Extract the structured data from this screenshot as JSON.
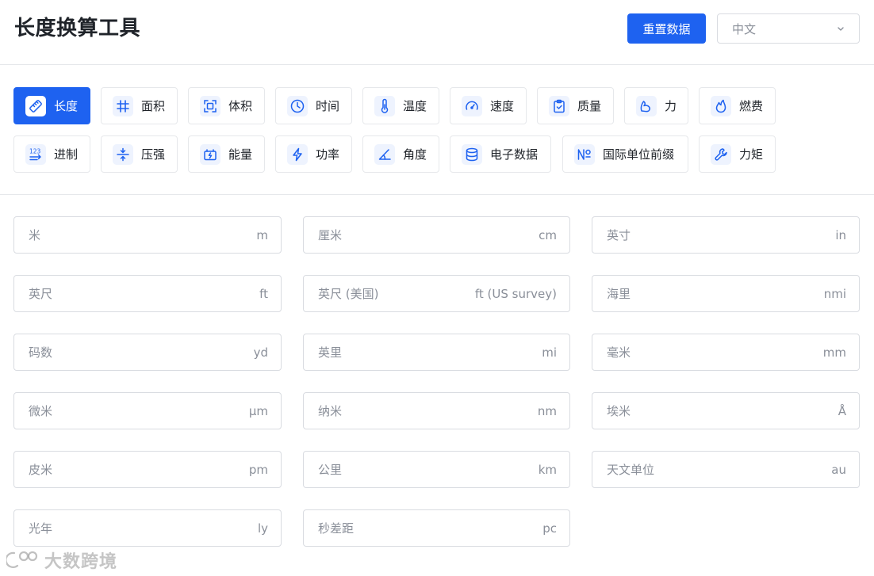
{
  "header": {
    "title": "长度换算工具",
    "reset_label": "重置数据",
    "language": {
      "selected": "中文"
    }
  },
  "colors": {
    "accent": "#1e62f0",
    "border": "#d9dce1",
    "muted": "#8a8f99"
  },
  "categories": [
    {
      "label": "长度",
      "icon": "ruler-icon",
      "active": true
    },
    {
      "label": "面积",
      "icon": "grid-hash-icon"
    },
    {
      "label": "体积",
      "icon": "volume-frame-icon"
    },
    {
      "label": "时间",
      "icon": "clock-icon"
    },
    {
      "label": "温度",
      "icon": "thermometer-icon"
    },
    {
      "label": "速度",
      "icon": "speedometer-icon"
    },
    {
      "label": "质量",
      "icon": "clipboard-icon"
    },
    {
      "label": "力",
      "icon": "bicep-icon"
    },
    {
      "label": "燃费",
      "icon": "flame-icon"
    },
    {
      "label": "进制",
      "icon": "number-base-icon"
    },
    {
      "label": "压强",
      "icon": "compress-icon"
    },
    {
      "label": "能量",
      "icon": "battery-icon"
    },
    {
      "label": "功率",
      "icon": "lightning-icon"
    },
    {
      "label": "角度",
      "icon": "angle-icon"
    },
    {
      "label": "电子数据",
      "icon": "database-icon"
    },
    {
      "label": "国际单位前缀",
      "icon": "numero-icon"
    },
    {
      "label": "力矩",
      "icon": "wrench-icon"
    }
  ],
  "fields": [
    {
      "name": "米",
      "unit": "m",
      "value": ""
    },
    {
      "name": "厘米",
      "unit": "cm",
      "value": ""
    },
    {
      "name": "英寸",
      "unit": "in",
      "value": ""
    },
    {
      "name": "英尺",
      "unit": "ft",
      "value": ""
    },
    {
      "name": "英尺 (美国)",
      "unit": "ft (US survey)",
      "value": ""
    },
    {
      "name": "海里",
      "unit": "nmi",
      "value": ""
    },
    {
      "name": "码数",
      "unit": "yd",
      "value": ""
    },
    {
      "name": "英里",
      "unit": "mi",
      "value": ""
    },
    {
      "name": "毫米",
      "unit": "mm",
      "value": ""
    },
    {
      "name": "微米",
      "unit": "µm",
      "value": ""
    },
    {
      "name": "纳米",
      "unit": "nm",
      "value": ""
    },
    {
      "name": "埃米",
      "unit": "Å",
      "value": ""
    },
    {
      "name": "皮米",
      "unit": "pm",
      "value": ""
    },
    {
      "name": "公里",
      "unit": "km",
      "value": ""
    },
    {
      "name": "天文单位",
      "unit": "au",
      "value": ""
    },
    {
      "name": "光年",
      "unit": "ly",
      "value": ""
    },
    {
      "name": "秒差距",
      "unit": "pc",
      "value": ""
    }
  ],
  "watermark": {
    "text": "大数跨境"
  }
}
